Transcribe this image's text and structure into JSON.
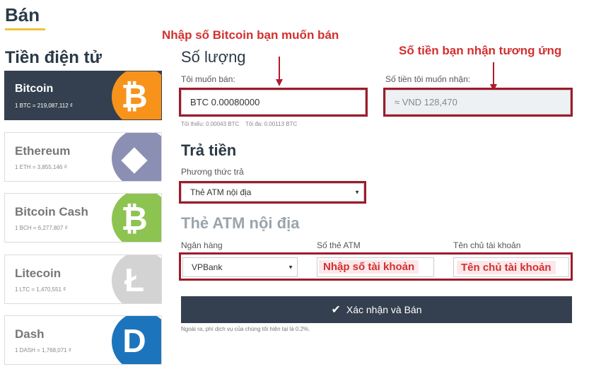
{
  "page": {
    "title": "Bán"
  },
  "sidebar": {
    "title": "Tiền điện tử",
    "coins": [
      {
        "name": "Bitcoin",
        "price": "1 BTC = 219,087,112 ₫",
        "icon": "bitcoin-icon",
        "glyph": "₿",
        "color": "#f7931a",
        "active": true
      },
      {
        "name": "Ethereum",
        "price": "1 ETH = 3,855,146 ₫",
        "icon": "ethereum-icon",
        "glyph": "◆",
        "color": "#8c8fb4",
        "active": false
      },
      {
        "name": "Bitcoin Cash",
        "price": "1 BCH = 6,277,807 ₫",
        "icon": "bitcoin-cash-icon",
        "glyph": "₿",
        "color": "#8dc351",
        "active": false
      },
      {
        "name": "Litecoin",
        "price": "1 LTC = 1,470,551 ₫",
        "icon": "litecoin-icon",
        "glyph": "Ł",
        "color": "#d3d3d3",
        "active": false
      },
      {
        "name": "Dash",
        "price": "1 DASH = 1,768,071 ₫",
        "icon": "dash-icon",
        "glyph": "D",
        "color": "#1c75bc",
        "active": false
      }
    ]
  },
  "amount": {
    "title": "Số lượng",
    "sell_label": "Tôi muốn bán:",
    "sell_value": "BTC 0.00080000",
    "receive_label": "Số tiền tôi muốn nhận:",
    "receive_value": "≈ VND 128,470",
    "limits": "Tối thiểu: 0.00043 BTC    Tối đa: 0.00113 BTC"
  },
  "payment": {
    "title": "Trả tiền",
    "method_label": "Phương thức trả",
    "method_value": "Thẻ ATM nội địa"
  },
  "atm": {
    "title": "Thẻ ATM nội địa",
    "bank_label": "Ngân hàng",
    "bank_value": "VPBank",
    "card_label": "Số thẻ ATM",
    "owner_label": "Tên chủ tài khoản"
  },
  "annotations": {
    "enter_btc": "Nhập số Bitcoin bạn muốn bán",
    "receive_amount": "Số tiền bạn nhận tương ứng",
    "enter_account": "Nhập số tài khoản",
    "owner_name": "Tên chủ tài khoản"
  },
  "submit": {
    "label": "Xác nhận và Bán"
  },
  "footer": {
    "fee_note": "Ngoài ra, phí dịch vụ của chúng tôi hiện tại là 0.2%."
  },
  "colors": {
    "accent": "#f0c23b",
    "dark": "#34404f",
    "annotation": "#d32f2f",
    "highlight_border": "#9e1b2b"
  }
}
